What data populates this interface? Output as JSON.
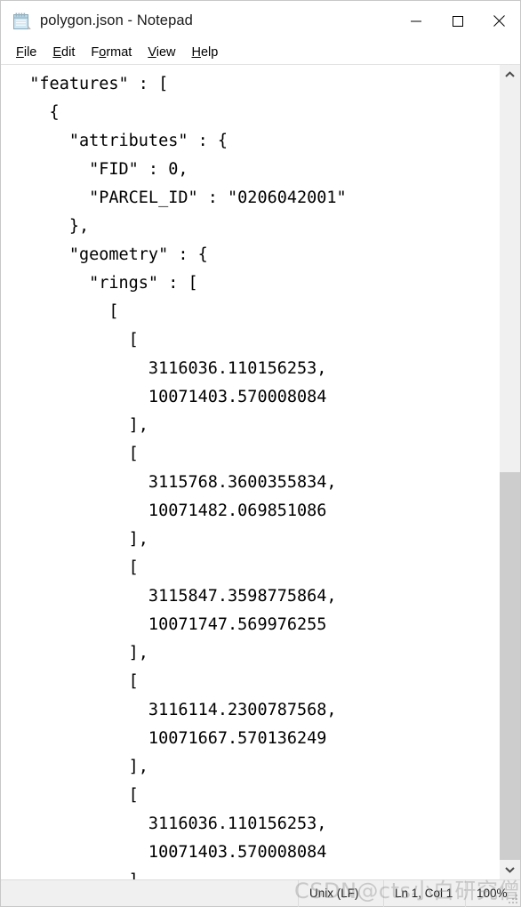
{
  "window": {
    "title": "polygon.json - Notepad",
    "icon": "notepad-icon",
    "controls": {
      "minimize": "minimize-icon",
      "maximize": "maximize-icon",
      "close": "close-icon"
    }
  },
  "menubar": {
    "items": [
      {
        "label": "File",
        "access_key": "F",
        "rest": "ile"
      },
      {
        "label": "Edit",
        "access_key": "E",
        "rest": "dit"
      },
      {
        "label": "Format",
        "access_key": "o",
        "pre": "F",
        "rest": "rmat"
      },
      {
        "label": "View",
        "access_key": "V",
        "rest": "iew"
      },
      {
        "label": "Help",
        "access_key": "H",
        "rest": "elp"
      }
    ]
  },
  "editor": {
    "content": "  \"features\" : [\n    {\n      \"attributes\" : {\n        \"FID\" : 0,\n        \"PARCEL_ID\" : \"0206042001\"\n      },\n      \"geometry\" : {\n        \"rings\" : [\n          [\n            [\n              3116036.110156253,\n              10071403.570008084\n            ],\n            [\n              3115768.3600355834,\n              10071482.069851086\n            ],\n            [\n              3115847.3598775864,\n              10071747.569976255\n            ],\n            [\n              3116114.2300787568,\n              10071667.570136249\n            ],\n            [\n              3116036.110156253,\n              10071403.570008084\n            ]\n          ]\n        ]\n      }\n    }\n  ]\n}"
  },
  "scrollbar": {
    "up_arrow": "chevron-up-icon",
    "down_arrow": "chevron-down-icon",
    "thumb_position": "bottom"
  },
  "statusbar": {
    "line_ending": "Unix (LF)",
    "cursor_position": "Ln 1, Col 1",
    "zoom": "100%"
  },
  "watermark": {
    "text": "CSDN@cts小白研究僧"
  },
  "colors": {
    "window_bg": "#ffffff",
    "statusbar_bg": "#f0f0f0",
    "scrollbar_track": "#f0f0f0",
    "scrollbar_thumb": "#cdcdcd",
    "text": "#000000"
  }
}
